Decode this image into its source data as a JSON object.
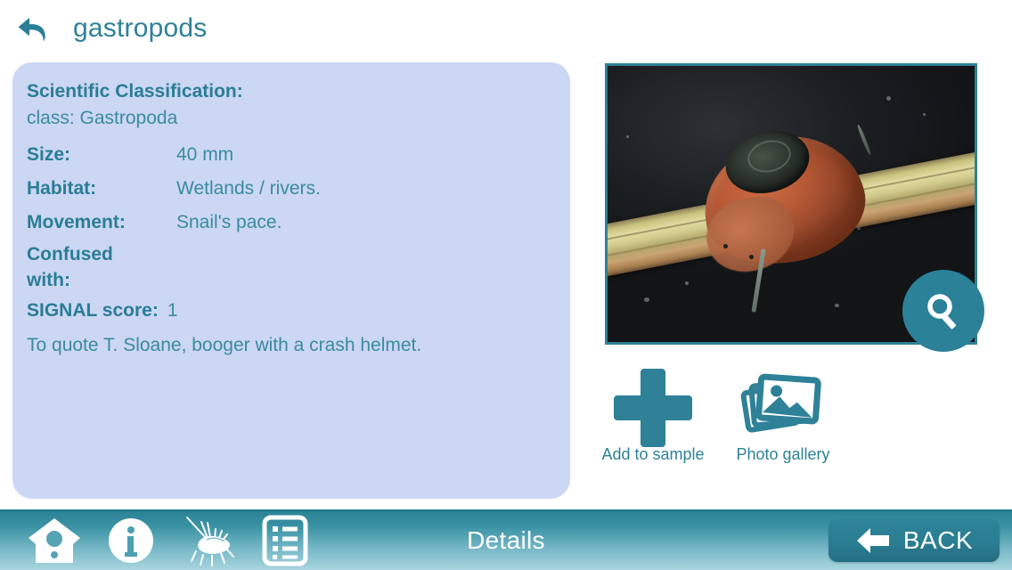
{
  "header": {
    "back_icon": "undo-arrow-icon",
    "title": "gastropods"
  },
  "info_panel": {
    "classification_label": "Scientific Classification:",
    "classification_value": "class: Gastropoda",
    "rows": [
      {
        "label": "Size:",
        "value": "40 mm"
      },
      {
        "label": "Habitat:",
        "value": "Wetlands / rivers."
      },
      {
        "label": "Movement:",
        "value": "Snail's pace."
      }
    ],
    "confused_label_line1": "Confused",
    "confused_label_line2": "with:",
    "confused_value": "",
    "signal_label": "SIGNAL score:",
    "signal_value": "1",
    "note": "To quote T. Sloane, booger with a crash helmet."
  },
  "photo": {
    "alt": "snail-on-plant-stem",
    "zoom_icon": "magnifier-icon"
  },
  "actions": [
    {
      "icon": "plus-icon",
      "caption": "Add to sample"
    },
    {
      "icon": "photo-stack-icon",
      "caption": "Photo gallery"
    }
  ],
  "toolbar": {
    "icons": [
      {
        "name": "home-birdhouse-icon"
      },
      {
        "name": "info-icon"
      },
      {
        "name": "invertebrate-icon"
      },
      {
        "name": "list-icon"
      }
    ],
    "title": "Details",
    "back_label": "BACK",
    "back_icon": "arrow-left-icon"
  },
  "colors": {
    "accent_teal": "#2e8197",
    "panel_blue": "#ccd7f4",
    "label_teal": "#2a7d96",
    "value_teal": "#3a8ba0",
    "toolbar_top": "#2a8296",
    "toolbar_bottom": "#a9d5df"
  }
}
